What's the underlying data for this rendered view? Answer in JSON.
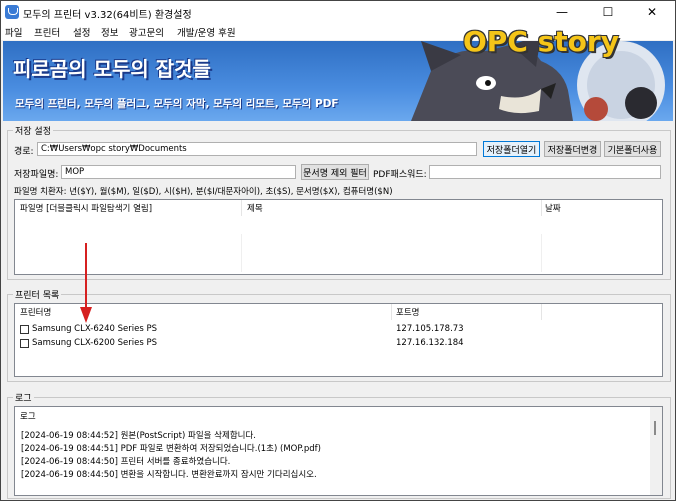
{
  "window": {
    "title": "모두의 프린터 v3.32(64비트) 환경설정"
  },
  "menu": [
    "파일",
    "프린터",
    "설정",
    "정보",
    "광고문의",
    "개발/운영 후원"
  ],
  "banner": {
    "title": "피로곰의 모두의 잡것들",
    "subtitle": "모두의 프린터, 모두의 플러그, 모두의 자막, 모두의 리모트, 모두의 PDF"
  },
  "overlay_logo": "OPC story",
  "save_settings": {
    "group_label": "저장 설정",
    "path_label": "경로:",
    "path_value": "C:₩Users₩opc story₩Documents",
    "open_folder_button": "저장폴더열기",
    "change_folder_button": "저장폴더변경",
    "default_folder_button": "기본폴더사용",
    "filename_label": "저장파일명:",
    "filename_value": "MOP",
    "filter_button": "문서명 제외 필터",
    "pdf_password_label": "PDF패스워드:",
    "pdf_password_value": "",
    "substitution_hint": "파일명 치환자: 년($Y), 월($M), 일($D), 시($H), 분($I/대문자아이), 초($S), 문서명($X), 컴퓨터명($N)",
    "columns": [
      "파일명 [더블클릭시 파일탐색기 열림]",
      "제목",
      "날짜"
    ]
  },
  "printer_list": {
    "group_label": "프린터 목록",
    "columns": [
      "프린터명",
      "포트명"
    ],
    "rows": [
      {
        "name": "Samsung CLX-6240 Series PS",
        "port": "127.105.178.73",
        "checked": false
      },
      {
        "name": "Samsung CLX-6200 Series PS",
        "port": "127.16.132.184",
        "checked": false
      }
    ]
  },
  "log": {
    "group_label": "로그",
    "column": "로그",
    "lines": [
      "[2024-06-19 08:44:52] 원본(PostScript) 파일을 삭제합니다.",
      "[2024-06-19 08:44:51] PDF 파일로 변환하여 저장되었습니다.(1초) (MOP.pdf)",
      "[2024-06-19 08:44:50] 프린터 서버를 종료하였습니다.",
      "[2024-06-19 08:44:50] 변환을 시작합니다. 변환완료까지 잠시만 기다리십시오."
    ]
  },
  "colors": {
    "banner": "#3a7bd5",
    "logo": "#f5c518",
    "arrow": "#d62020",
    "focus": "#0078d7"
  },
  "icons": [
    "app-icon",
    "minimize-icon",
    "maximize-icon",
    "close-icon",
    "checkbox-icon",
    "red-arrow-annotation",
    "bear-mascot-illustration"
  ]
}
